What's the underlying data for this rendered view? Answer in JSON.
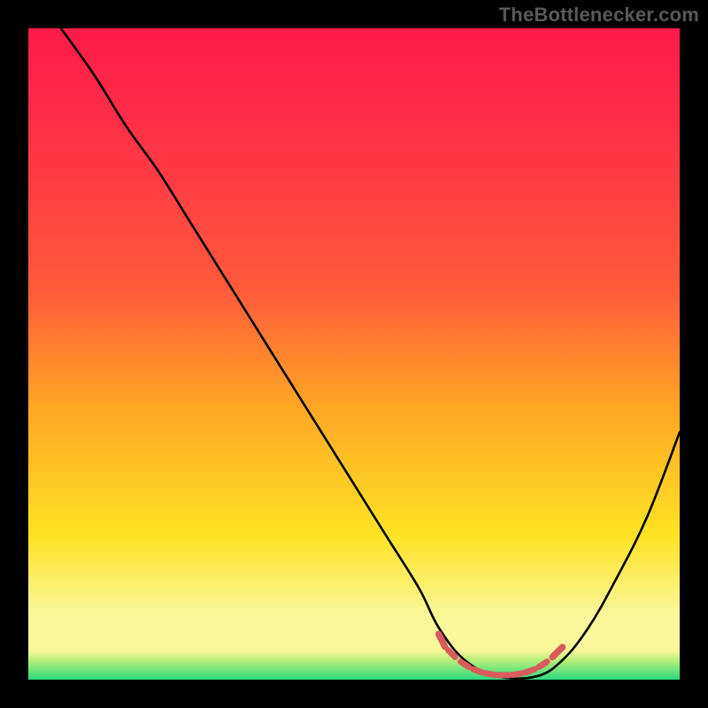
{
  "watermark": "TheBottlenecker.com",
  "colors": {
    "background": "#000000",
    "gradient_top": "#ff1a4b",
    "gradient_mid1": "#ff5a3a",
    "gradient_mid2": "#ffa624",
    "gradient_mid3": "#ffe324",
    "gradient_band": "#faf89a",
    "gradient_bottom": "#2bd97e",
    "curve": "#000000",
    "marker": "#d95b5b"
  },
  "chart_data": {
    "type": "line",
    "title": "",
    "xlabel": "",
    "ylabel": "",
    "xlim": [
      0,
      100
    ],
    "ylim": [
      0,
      100
    ],
    "grid": false,
    "series": [
      {
        "name": "curve",
        "x": [
          5,
          10,
          15,
          20,
          25,
          30,
          35,
          40,
          45,
          50,
          55,
          60,
          63,
          67,
          72,
          78,
          82,
          86,
          90,
          95,
          100
        ],
        "y": [
          100,
          93,
          85,
          78,
          70,
          62,
          54,
          46,
          38,
          30,
          22,
          14,
          8,
          3,
          0.5,
          0.5,
          3,
          8,
          15,
          25,
          38
        ]
      }
    ],
    "markers": {
      "name": "highlight-range",
      "x": [
        63,
        64,
        66,
        68,
        70,
        72,
        74,
        76,
        78,
        80,
        82
      ],
      "y": [
        7,
        5,
        3,
        1.7,
        1,
        0.7,
        0.7,
        1,
        1.7,
        3,
        5
      ]
    }
  }
}
